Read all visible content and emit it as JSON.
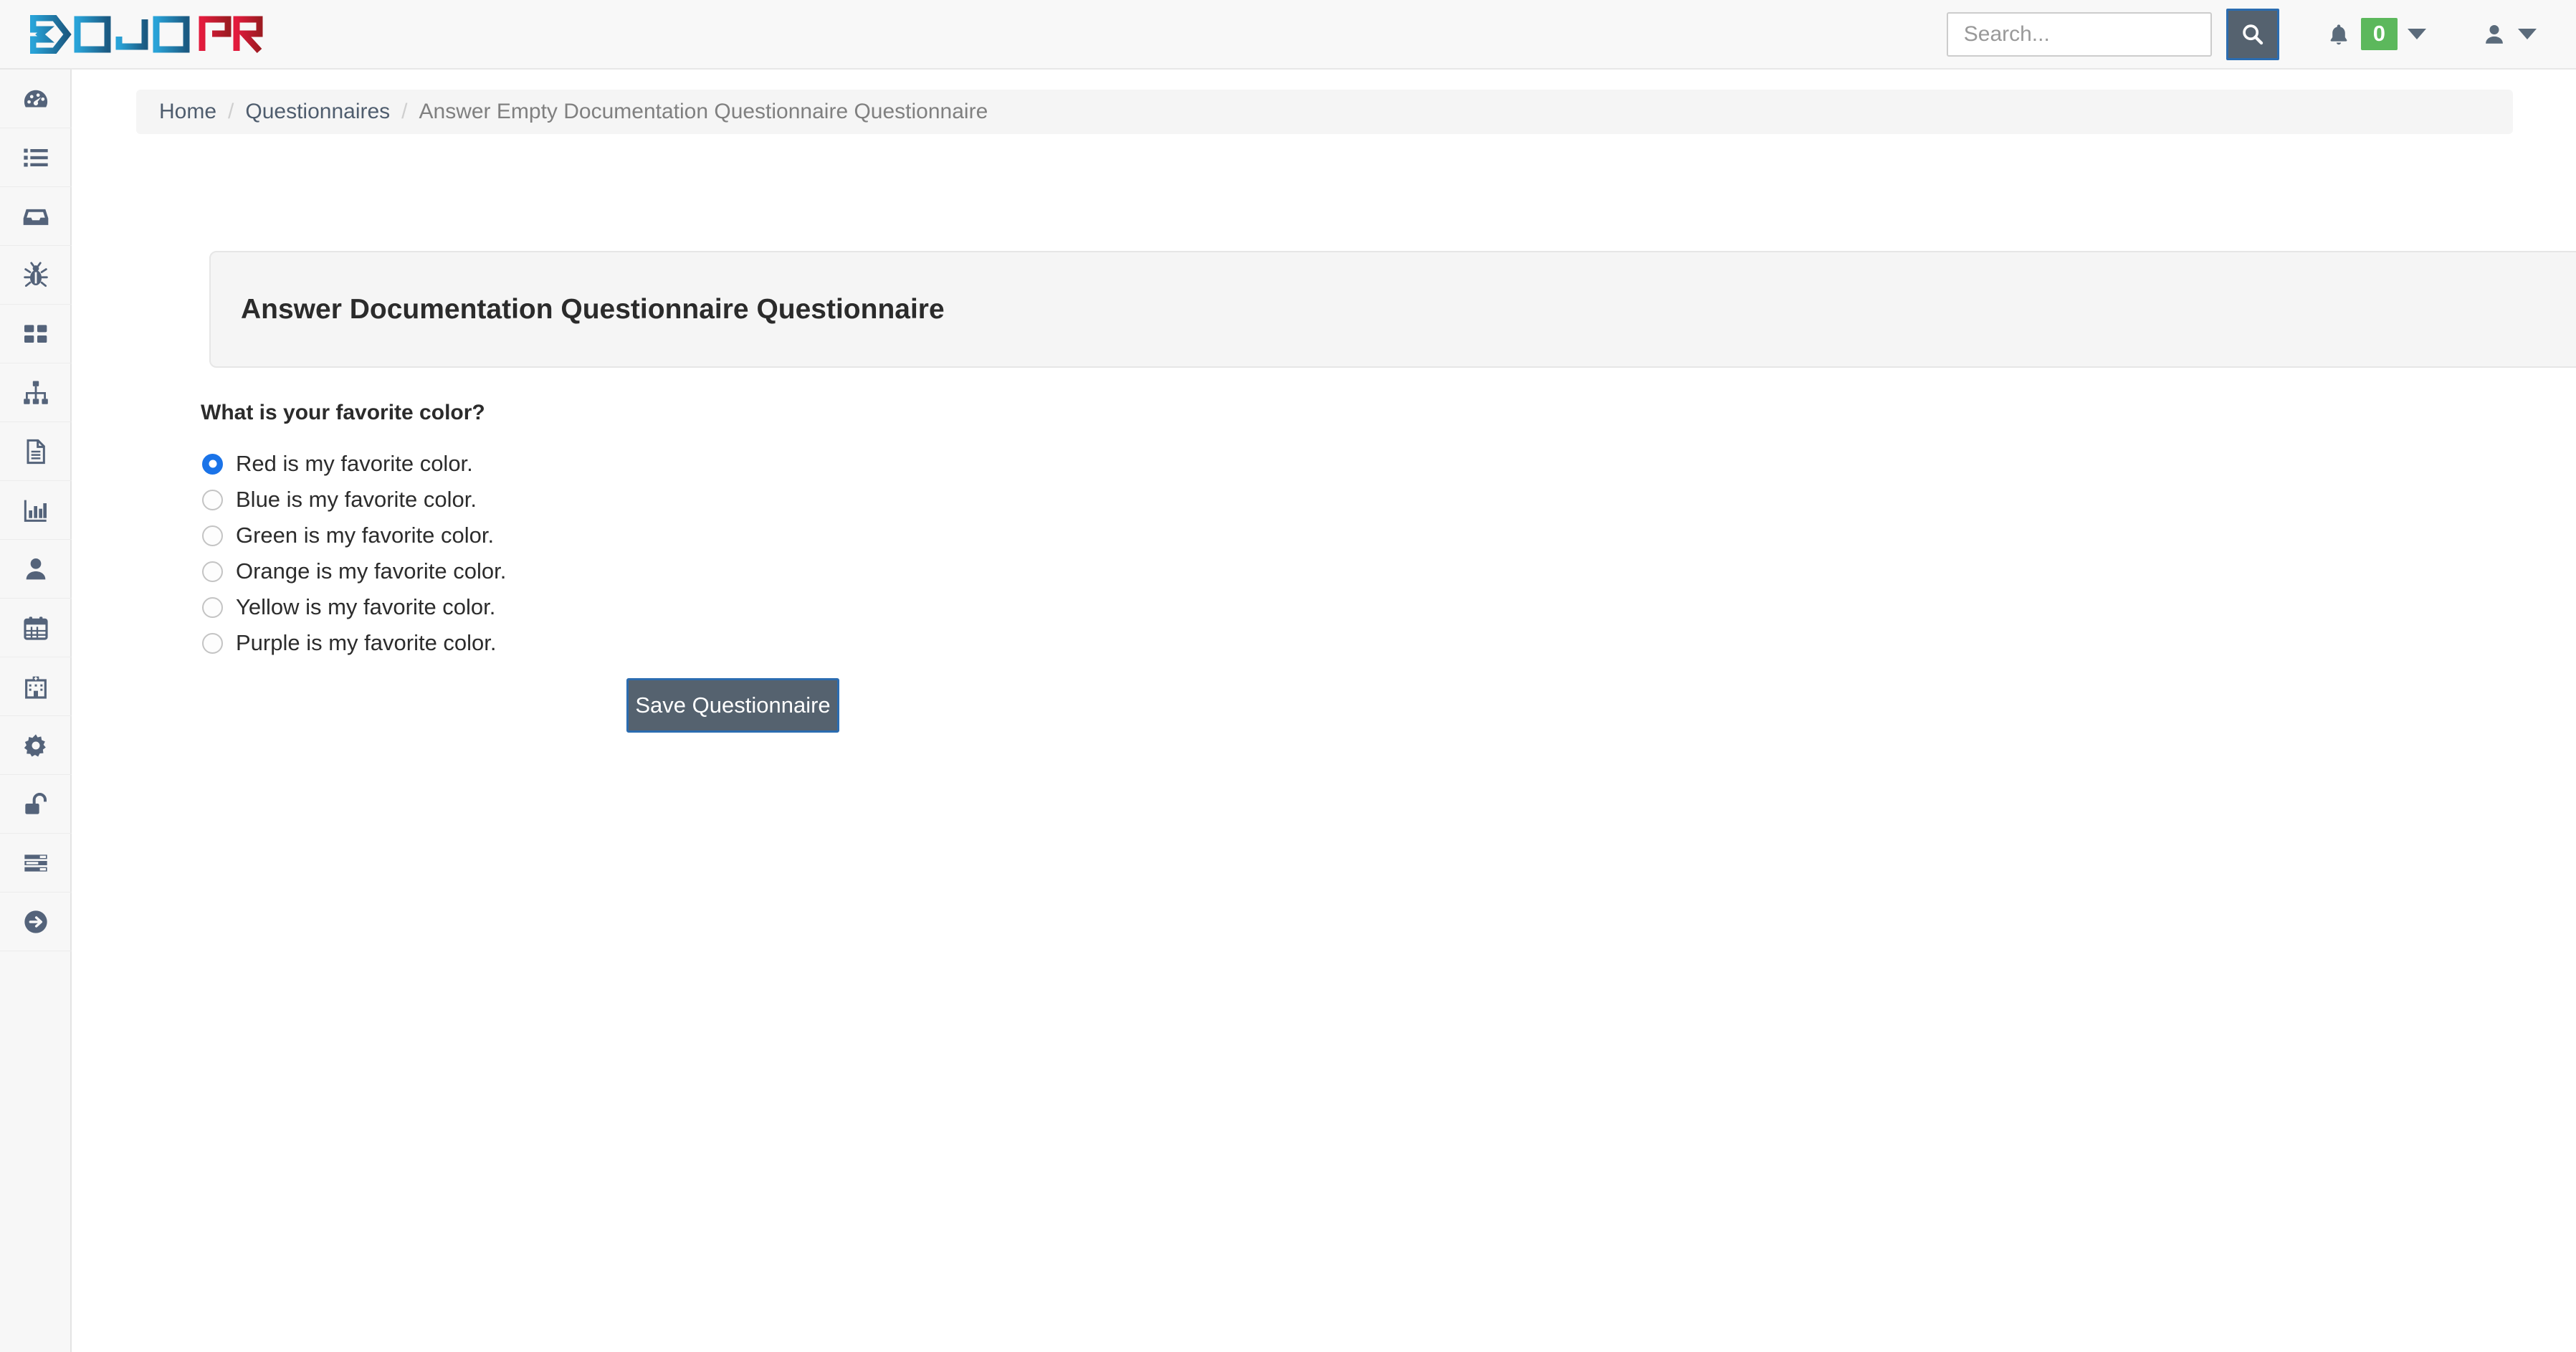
{
  "header": {
    "logo": {
      "name": "dojopro-logo",
      "text_left": "DOJO",
      "text_right": "PRO",
      "color_left_start": "#29a3d8",
      "color_left_end": "#1b5a82",
      "color_right_start": "#e31b3d",
      "color_right_end": "#9e1b22"
    },
    "search": {
      "placeholder": "Search...",
      "value": "",
      "button_icon": "search-icon",
      "button_color": "#55626f"
    },
    "notifications": {
      "icon": "bell-icon",
      "count": "0",
      "badge_color": "#5cb85c",
      "caret_icon": "caret-down-icon"
    },
    "user": {
      "icon": "user-icon",
      "caret_icon": "caret-down-icon"
    }
  },
  "sidebar": {
    "items": [
      {
        "icon": "tachometer-dashboard-icon",
        "name": "sidebar-item-dashboard"
      },
      {
        "icon": "list-icon",
        "name": "sidebar-item-list"
      },
      {
        "icon": "inbox-icon",
        "name": "sidebar-item-inbox"
      },
      {
        "icon": "bug-icon",
        "name": "sidebar-item-findings"
      },
      {
        "icon": "grid-th-icon",
        "name": "sidebar-item-components"
      },
      {
        "icon": "sitemap-icon",
        "name": "sidebar-item-sitemap"
      },
      {
        "icon": "file-text-icon",
        "name": "sidebar-item-documents"
      },
      {
        "icon": "bar-chart-icon",
        "name": "sidebar-item-metrics"
      },
      {
        "icon": "user-icon",
        "name": "sidebar-item-users"
      },
      {
        "icon": "calendar-icon",
        "name": "sidebar-item-calendar"
      },
      {
        "icon": "building-hospital-icon",
        "name": "sidebar-item-organization"
      },
      {
        "icon": "gear-icon",
        "name": "sidebar-item-settings"
      },
      {
        "icon": "unlock-icon",
        "name": "sidebar-item-credentials"
      },
      {
        "icon": "server-tasks-icon",
        "name": "sidebar-item-tasks"
      },
      {
        "icon": "arrow-circle-right-icon",
        "name": "sidebar-item-signout"
      }
    ]
  },
  "breadcrumb": {
    "items": [
      {
        "label": "Home",
        "active": false
      },
      {
        "label": "Questionnaires",
        "active": false
      },
      {
        "label": "Answer Empty Documentation Questionnaire Questionnaire",
        "active": true
      }
    ],
    "separator": "/"
  },
  "panel": {
    "title": "Answer Documentation Questionnaire Questionnaire"
  },
  "form": {
    "question": "What is your favorite color?",
    "options": [
      {
        "label": "Red is my favorite color.",
        "selected": true
      },
      {
        "label": "Blue is my favorite color.",
        "selected": false
      },
      {
        "label": "Green is my favorite color.",
        "selected": false
      },
      {
        "label": "Orange is my favorite color.",
        "selected": false
      },
      {
        "label": "Yellow is my favorite color.",
        "selected": false
      },
      {
        "label": "Purple is my favorite color.",
        "selected": false
      }
    ],
    "save_label": "Save Questionnaire"
  }
}
